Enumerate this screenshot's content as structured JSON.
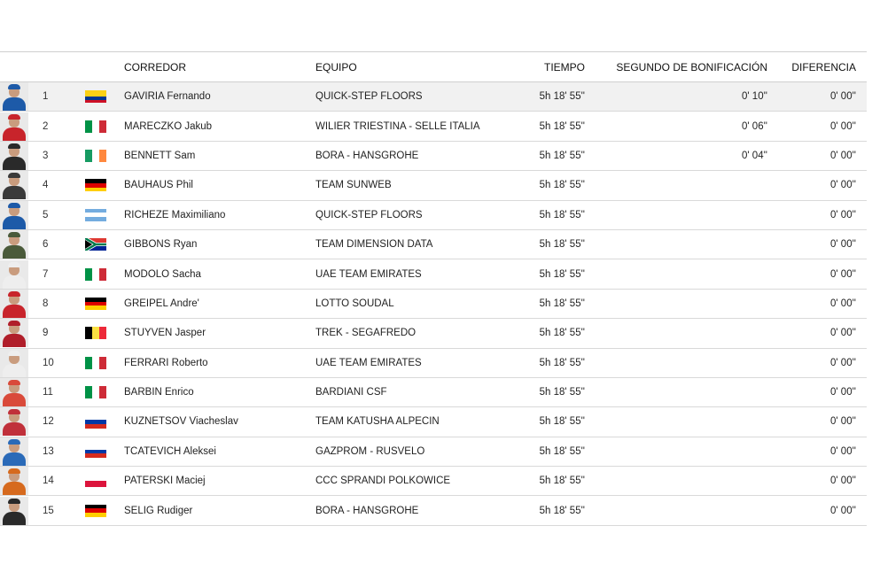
{
  "header": {
    "rider": "CORREDOR",
    "team": "EQUIPO",
    "time": "TIEMPO",
    "bonus": "SEGUNDO DE BONIFICACIÓN",
    "diff": "DIFERENCIA"
  },
  "rows": [
    {
      "pos": "1",
      "rider": "GAVIRIA Fernando",
      "team": "QUICK-STEP FLOORS",
      "time": "5h 18' 55''",
      "bonus": "0' 10''",
      "diff": "0' 00''",
      "flag": "colombia",
      "kit": "#1d5aa8"
    },
    {
      "pos": "2",
      "rider": "MARECZKO Jakub",
      "team": "WILIER TRIESTINA - SELLE ITALIA",
      "time": "5h 18' 55''",
      "bonus": "0' 06''",
      "diff": "0' 00''",
      "flag": "italy",
      "kit": "#c8242b"
    },
    {
      "pos": "3",
      "rider": "BENNETT Sam",
      "team": "BORA - HANSGROHE",
      "time": "5h 18' 55''",
      "bonus": "0' 04''",
      "diff": "0' 00''",
      "flag": "ireland",
      "kit": "#2a2a2a"
    },
    {
      "pos": "4",
      "rider": "BAUHAUS Phil",
      "team": "TEAM SUNWEB",
      "time": "5h 18' 55''",
      "bonus": "",
      "diff": "0' 00''",
      "flag": "germany",
      "kit": "#3a3a3a"
    },
    {
      "pos": "5",
      "rider": "RICHEZE Maximiliano",
      "team": "QUICK-STEP FLOORS",
      "time": "5h 18' 55''",
      "bonus": "",
      "diff": "0' 00''",
      "flag": "argentina",
      "kit": "#1d5aa8"
    },
    {
      "pos": "6",
      "rider": "GIBBONS Ryan",
      "team": "TEAM DIMENSION DATA",
      "time": "5h 18' 55''",
      "bonus": "",
      "diff": "0' 00''",
      "flag": "southafrica",
      "kit": "#4a5a3a"
    },
    {
      "pos": "7",
      "rider": "MODOLO Sacha",
      "team": "UAE TEAM EMIRATES",
      "time": "5h 18' 55''",
      "bonus": "",
      "diff": "0' 00''",
      "flag": "italy",
      "kit": "#eeeeee"
    },
    {
      "pos": "8",
      "rider": "GREIPEL Andre'",
      "team": "LOTTO SOUDAL",
      "time": "5h 18' 55''",
      "bonus": "",
      "diff": "0' 00''",
      "flag": "germany",
      "kit": "#c8242b"
    },
    {
      "pos": "9",
      "rider": "STUYVEN Jasper",
      "team": "TREK - SEGAFREDO",
      "time": "5h 18' 55''",
      "bonus": "",
      "diff": "0' 00''",
      "flag": "belgium",
      "kit": "#b01e2a"
    },
    {
      "pos": "10",
      "rider": "FERRARI Roberto",
      "team": "UAE TEAM EMIRATES",
      "time": "5h 18' 55''",
      "bonus": "",
      "diff": "0' 00''",
      "flag": "italy",
      "kit": "#eeeeee"
    },
    {
      "pos": "11",
      "rider": "BARBIN Enrico",
      "team": "BARDIANI CSF",
      "time": "5h 18' 55''",
      "bonus": "",
      "diff": "0' 00''",
      "flag": "italy",
      "kit": "#d94a3a"
    },
    {
      "pos": "12",
      "rider": "KUZNETSOV Viacheslav",
      "team": "TEAM KATUSHA ALPECIN",
      "time": "5h 18' 55''",
      "bonus": "",
      "diff": "0' 00''",
      "flag": "russia",
      "kit": "#c0303a"
    },
    {
      "pos": "13",
      "rider": "TCATEVICH Aleksei",
      "team": "GAZPROM - RUSVELO",
      "time": "5h 18' 55''",
      "bonus": "",
      "diff": "0' 00''",
      "flag": "russia",
      "kit": "#2a6ab8"
    },
    {
      "pos": "14",
      "rider": "PATERSKI Maciej",
      "team": "CCC SPRANDI POLKOWICE",
      "time": "5h 18' 55''",
      "bonus": "",
      "diff": "0' 00''",
      "flag": "poland",
      "kit": "#d66a1e"
    },
    {
      "pos": "15",
      "rider": "SELIG Rudiger",
      "team": "BORA - HANSGROHE",
      "time": "5h 18' 55''",
      "bonus": "",
      "diff": "0' 00''",
      "flag": "germany",
      "kit": "#2a2a2a"
    }
  ],
  "flags": {
    "colombia": {
      "dir": "h",
      "colors": [
        "#fcd116",
        "#fcd116",
        "#003893",
        "#ce1126"
      ]
    },
    "italy": {
      "dir": "v",
      "colors": [
        "#009246",
        "#ffffff",
        "#ce2b37"
      ]
    },
    "ireland": {
      "dir": "v",
      "colors": [
        "#169b62",
        "#ffffff",
        "#ff883e"
      ]
    },
    "germany": {
      "dir": "h",
      "colors": [
        "#000000",
        "#dd0000",
        "#ffce00"
      ]
    },
    "argentina": {
      "dir": "h",
      "colors": [
        "#74acdf",
        "#ffffff",
        "#74acdf"
      ]
    },
    "belgium": {
      "dir": "v",
      "colors": [
        "#000000",
        "#fae042",
        "#ed2939"
      ]
    },
    "russia": {
      "dir": "h",
      "colors": [
        "#ffffff",
        "#0039a6",
        "#d52b1e"
      ]
    },
    "poland": {
      "dir": "h",
      "colors": [
        "#ffffff",
        "#dc143c"
      ]
    },
    "southafrica": {
      "dir": "sa",
      "colors": [
        "#007a4d",
        "#000000",
        "#ffb612",
        "#de3831",
        "#002395",
        "#ffffff"
      ]
    }
  }
}
